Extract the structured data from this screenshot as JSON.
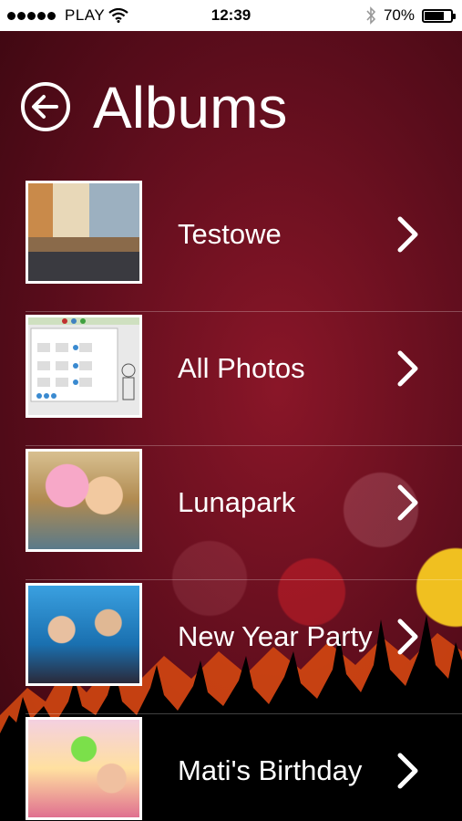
{
  "status_bar": {
    "carrier": "PLAY",
    "time": "12:39",
    "battery_percent": "70%",
    "battery_level": 0.7,
    "signal_bars": 5
  },
  "header": {
    "title": "Albums",
    "back_icon": "arrow-left-circle-icon"
  },
  "albums": [
    {
      "title": "Testowe"
    },
    {
      "title": "All Photos"
    },
    {
      "title": "Lunapark"
    },
    {
      "title": "New Year Party"
    },
    {
      "title": "Mati's Birthday"
    }
  ],
  "colors": {
    "background_red": "#8a1628",
    "text": "#ffffff",
    "status_bar_bg": "#ffffff"
  }
}
